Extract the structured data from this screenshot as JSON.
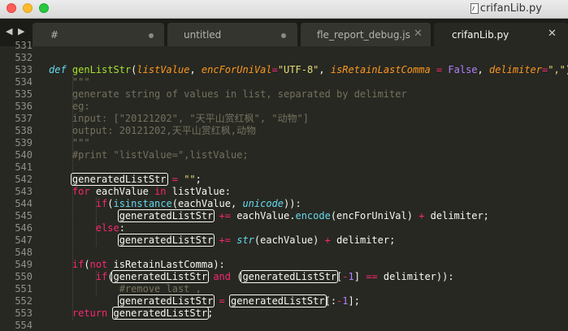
{
  "window": {
    "title": "crifanLib.py",
    "colors": {
      "close": "#fc5f57",
      "minimize": "#fdbc2e",
      "maximize": "#28c840"
    }
  },
  "tabs": [
    {
      "label": "#",
      "state": "modified"
    },
    {
      "label": "untitled",
      "state": "modified"
    },
    {
      "label": "fle_report_debug.js",
      "state": "closable"
    },
    {
      "label": "crifanLib.py",
      "state": "active"
    }
  ],
  "editor": {
    "theme": "Monokai",
    "first_line_partial": "531",
    "lines": [
      {
        "n": "532",
        "html": ""
      },
      {
        "n": "533",
        "html": "<span class=\"def\">def</span> <span class=\"fn\">genListStr</span>(<span class=\"param\">listValue</span>, <span class=\"param\">encForUniVal</span><span class=\"kw\">=</span><span class=\"str\">\"UTF-8\"</span>, <span class=\"param\">isRetainLastComma</span> <span class=\"kw\">=</span> <span class=\"const\">False</span>, <span class=\"param\">delimiter</span><span class=\"kw\">=</span><span class=\"str\">\",\"</span>):"
      },
      {
        "n": "534",
        "html": "    <span class=\"cmt\">\"\"\"</span>"
      },
      {
        "n": "535",
        "html": "    <span class=\"cmt\">generate string of values in list, separated by delimiter</span>"
      },
      {
        "n": "536",
        "html": "    <span class=\"cmt\">eg:</span>"
      },
      {
        "n": "537",
        "html": "    <span class=\"cmt\">input: [\"20121202\", \"天平山赏红枫\", \"动物\"]</span>"
      },
      {
        "n": "538",
        "html": "    <span class=\"cmt\">output: 20121202,天平山赏红枫,动物</span>"
      },
      {
        "n": "539",
        "html": "    <span class=\"cmt\">\"\"\"</span>"
      },
      {
        "n": "540",
        "html": "    <span class=\"cmt\">#print \"listValue=\",listValue;</span>"
      },
      {
        "n": "541",
        "html": ""
      },
      {
        "n": "542",
        "html": "    <span class=\"hl\">generatedListStr</span> <span class=\"kw\">=</span> <span class=\"str\">\"\"</span>;"
      },
      {
        "n": "543",
        "html": "    <span class=\"kw\">for</span> eachValue <span class=\"kw\">in</span> listValue:"
      },
      {
        "n": "544",
        "html": "        <span class=\"kw\">if</span>(<span class=\"bi\">isinstance</span>(eachValue, <span class=\"bii\">unicode</span>)):"
      },
      {
        "n": "545",
        "html": "            <span class=\"hl\">generatedListStr</span> <span class=\"kw\">+=</span> eachValue.<span class=\"bi\">encode</span>(encForUniVal) <span class=\"kw\">+</span> delimiter;"
      },
      {
        "n": "546",
        "html": "        <span class=\"kw\">else</span>:"
      },
      {
        "n": "547",
        "html": "            <span class=\"hl\">generatedListStr</span> <span class=\"kw\">+=</span> <span class=\"bii\">str</span>(eachValue) <span class=\"kw\">+</span> delimiter;"
      },
      {
        "n": "548",
        "html": ""
      },
      {
        "n": "549",
        "html": "    <span class=\"kw\">if</span>(<span class=\"kw\">not</span> isRetainLastComma):"
      },
      {
        "n": "550",
        "html": "        <span class=\"kw\">if</span>(<span class=\"hl\">generatedListStr</span> <span class=\"kw\">and</span> (<span class=\"hl\">generatedListStr</span>[<span class=\"kw\">-</span><span class=\"num\">1</span>] <span class=\"kw\">==</span> delimiter)):"
      },
      {
        "n": "551",
        "html": "            <span class=\"cmt\">#remove last ,</span>"
      },
      {
        "n": "552",
        "html": "            <span class=\"hl\">generatedListStr</span> <span class=\"kw\">=</span> <span class=\"hl\">generatedListStr</span>[:<span class=\"kw\">-</span><span class=\"num\">1</span>];"
      },
      {
        "n": "553",
        "html": "    <span class=\"kw\">return</span> <span class=\"hl\">generatedListStr</span>;"
      },
      {
        "n": "554",
        "html": ""
      }
    ]
  }
}
